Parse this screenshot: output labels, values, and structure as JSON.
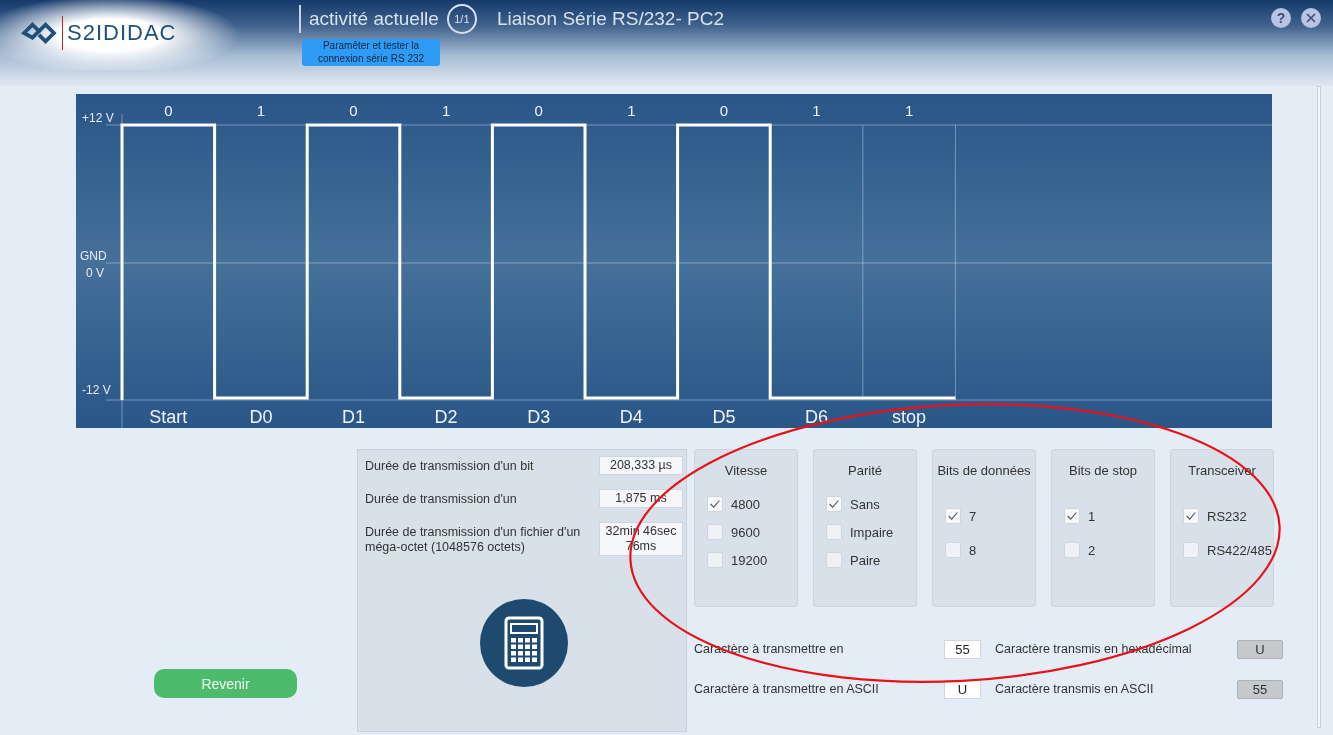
{
  "header": {
    "logo": "S2IDIDAC",
    "activity_label": "activité actuelle",
    "activity_count": "1/1",
    "title": "Liaison Série RS/232- PC2",
    "task_button": "Paramêter et tester la connexion série RS 232"
  },
  "signal": {
    "y_labels": {
      "high": "+12 V",
      "ground": [
        "GND",
        "0 V"
      ],
      "low": "-12 V"
    },
    "bits": [
      {
        "value": "0",
        "name": "Start",
        "kind": "high"
      },
      {
        "value": "1",
        "name": "D0",
        "kind": "low"
      },
      {
        "value": "0",
        "name": "D1",
        "kind": "high"
      },
      {
        "value": "1",
        "name": "D2",
        "kind": "low"
      },
      {
        "value": "0",
        "name": "D3",
        "kind": "high"
      },
      {
        "value": "1",
        "name": "D4",
        "kind": "low"
      },
      {
        "value": "0",
        "name": "D5",
        "kind": "high"
      },
      {
        "value": "1",
        "name": "D6",
        "kind": "low"
      },
      {
        "value": "1",
        "name": "stop",
        "kind": "low"
      }
    ]
  },
  "durations": [
    {
      "label": "Durée de transmission d'un bit",
      "value": "208,333 µs"
    },
    {
      "label": "Durée de transmission d'un",
      "value": "1,875 ms"
    },
    {
      "label": "Durée de transmission d'un fichier d'un méga-octet (1048576 octets)",
      "value": "32min 46sec 76ms"
    }
  ],
  "groups": [
    {
      "title": "Vitesse",
      "options": [
        {
          "label": "4800",
          "checked": true
        },
        {
          "label": "9600",
          "checked": false
        },
        {
          "label": "19200",
          "checked": false
        }
      ]
    },
    {
      "title": "Parité",
      "options": [
        {
          "label": "Sans",
          "checked": true
        },
        {
          "label": "Impaire",
          "checked": false
        },
        {
          "label": "Paire",
          "checked": false
        }
      ]
    },
    {
      "title": "Bits de données",
      "options": [
        {
          "label": "7",
          "checked": true
        },
        {
          "label": "8",
          "checked": false
        }
      ]
    },
    {
      "title": "Bits de stop",
      "options": [
        {
          "label": "1",
          "checked": true
        },
        {
          "label": "2",
          "checked": false
        }
      ]
    },
    {
      "title": "Transceiver",
      "options": [
        {
          "label": "RS232",
          "checked": true
        },
        {
          "label": "RS422/485",
          "checked": false
        }
      ]
    }
  ],
  "characters": [
    {
      "input_label": "Caractère à transmettre en",
      "input": "55",
      "output_label": "Caractère transmis en hexadécimal",
      "output": "U"
    },
    {
      "input_label": "Caractère à transmettre en ASCII",
      "input": "U",
      "output_label": "Caractère transmis en ASCII",
      "output": "55"
    }
  ],
  "back_button": "Revenir",
  "help_button": "?"
}
